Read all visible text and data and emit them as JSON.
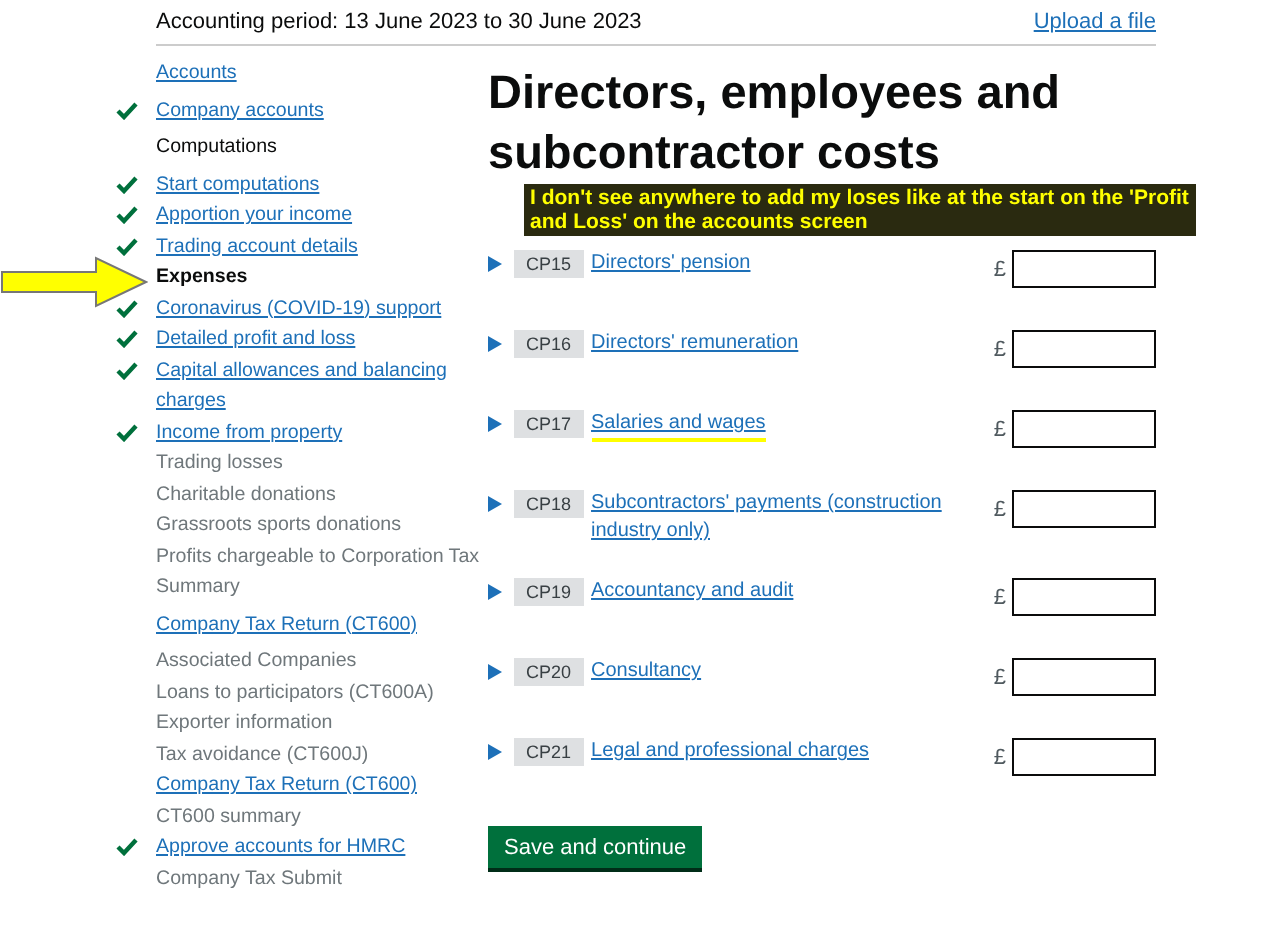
{
  "header": {
    "period": "Accounting period: 13 June 2023 to 30 June 2023",
    "upload_link": "Upload a file"
  },
  "sidebar": {
    "sections": [
      {
        "items": [
          {
            "label": "Accounts",
            "kind": "link",
            "completed": false
          }
        ]
      },
      {
        "items": [
          {
            "label": "Company accounts",
            "kind": "link",
            "completed": true
          }
        ]
      },
      {
        "items": [
          {
            "label": "Computations",
            "kind": "heading",
            "completed": false
          }
        ]
      },
      {
        "items": [
          {
            "label": "Start computations",
            "kind": "link",
            "completed": true
          },
          {
            "label": "Apportion your income",
            "kind": "link",
            "completed": true
          },
          {
            "label": "Trading account details",
            "kind": "link",
            "completed": true
          },
          {
            "label": "Expenses",
            "kind": "current",
            "completed": false
          },
          {
            "label": "Coronavirus (COVID-19) support",
            "kind": "link",
            "completed": true
          },
          {
            "label": "Detailed profit and loss",
            "kind": "link",
            "completed": true
          },
          {
            "label": "Capital allowances and balancing charges",
            "kind": "link",
            "completed": true
          },
          {
            "label": "Income from property",
            "kind": "link",
            "completed": true
          },
          {
            "label": "Trading losses",
            "kind": "disabled",
            "completed": false
          },
          {
            "label": "Charitable donations",
            "kind": "disabled",
            "completed": false
          },
          {
            "label": "Grassroots sports donations",
            "kind": "disabled",
            "completed": false
          },
          {
            "label": "Profits chargeable to Corporation Tax",
            "kind": "disabled",
            "completed": false
          },
          {
            "label": "Summary",
            "kind": "disabled",
            "completed": false
          }
        ]
      },
      {
        "items": [
          {
            "label": "Company Tax Return (CT600)",
            "kind": "link",
            "completed": false
          }
        ]
      },
      {
        "items": [
          {
            "label": "Associated Companies",
            "kind": "disabled",
            "completed": false
          },
          {
            "label": "Loans to participators (CT600A)",
            "kind": "disabled",
            "completed": false
          },
          {
            "label": "Exporter information",
            "kind": "disabled",
            "completed": false
          },
          {
            "label": "Tax avoidance (CT600J)",
            "kind": "disabled",
            "completed": false
          },
          {
            "label": "Company Tax Return (CT600)",
            "kind": "link",
            "completed": false
          },
          {
            "label": "CT600 summary",
            "kind": "disabled",
            "completed": false
          },
          {
            "label": "Approve accounts for HMRC",
            "kind": "link",
            "completed": true
          },
          {
            "label": "Company Tax Submit",
            "kind": "disabled",
            "completed": false
          }
        ]
      }
    ]
  },
  "title": "Directors, employees and subcontractor costs",
  "annotation": {
    "text": "I don't see anywhere to add my loses like at the start on the 'Profit and Loss' on the accounts screen"
  },
  "rows": [
    {
      "code": "CP15",
      "label": "Directors' pension",
      "currency": "£",
      "highlighted": false
    },
    {
      "code": "CP16",
      "label": "Directors' remuneration",
      "currency": "£",
      "highlighted": false
    },
    {
      "code": "CP17",
      "label": "Salaries and wages",
      "currency": "£",
      "highlighted": true
    },
    {
      "code": "CP18",
      "label": "Subcontractors' payments (construction industry only)",
      "currency": "£",
      "highlighted": false
    },
    {
      "code": "CP19",
      "label": "Accountancy and audit",
      "currency": "£",
      "highlighted": false
    },
    {
      "code": "CP20",
      "label": "Consultancy",
      "currency": "£",
      "highlighted": false
    },
    {
      "code": "CP21",
      "label": "Legal and professional charges",
      "currency": "£",
      "highlighted": false
    }
  ],
  "save_button": "Save and continue"
}
